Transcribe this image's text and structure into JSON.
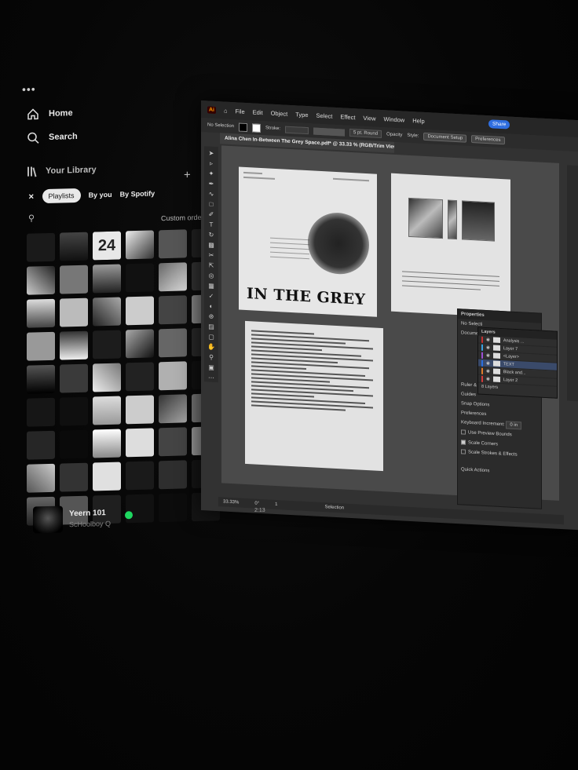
{
  "spotify": {
    "menu_glyph": "•••",
    "nav": [
      {
        "label": "Home",
        "icon": "home-icon"
      },
      {
        "label": "Search",
        "icon": "search-icon"
      }
    ],
    "library_label": "Your Library",
    "add_glyph": "+",
    "close_glyph": "✕",
    "filters": [
      "Playlists",
      "By you",
      "By Spotify"
    ],
    "sort_label": "Custom order",
    "tile_number": "24",
    "now_playing": {
      "title": "Yeern 101",
      "artist": "ScHoolboy Q"
    }
  },
  "illustrator": {
    "app_logo": "Ai",
    "menu": [
      "File",
      "Edit",
      "Object",
      "Type",
      "Select",
      "Effect",
      "View",
      "Window",
      "Help"
    ],
    "share_label": "Share",
    "control_bar": {
      "selection": "No Selection",
      "stroke_label": "Stroke:",
      "brush": "5 pt. Round",
      "opacity_label": "Opacity",
      "style_label": "Style:",
      "document_setup": "Document Setup",
      "preferences": "Preferences"
    },
    "doc_tab": "Alina Chen In-Between The Grey Space.pdf* @ 33.33 % (RGB/Trim View)",
    "artboard_headline": "IN THE GREY",
    "properties": {
      "title": "Properties",
      "no_selection": "No Selecti",
      "document": "Documen",
      "ruler": "Ruler & G",
      "guides": "Guides",
      "snap": "Snap Options",
      "preferences": "Preferences",
      "keyboard_increment": "Keyboard Increment:",
      "increment_value": "0 in",
      "checks": [
        "Use Preview Bounds",
        "Scale Corners",
        "Scale Strokes & Effects"
      ],
      "quick_actions": "Quick Actions"
    },
    "layers": {
      "title": "Layers",
      "count": "8 Layers",
      "items": [
        {
          "name": "Analysis ...",
          "color": "#c43030"
        },
        {
          "name": "Layer 7",
          "color": "#3aa0e0"
        },
        {
          "name": "<Layer>",
          "color": "#9c4fd6"
        },
        {
          "name": "TEXT",
          "color": "#2a6fe0"
        },
        {
          "name": "Black and...",
          "color": "#e07c2a"
        },
        {
          "name": "Layer 2",
          "color": "#d63a3a"
        }
      ]
    },
    "status": {
      "zoom": "33.33%",
      "rotation": "0°",
      "page": "1",
      "tool": "Selection"
    },
    "time": "2:13"
  }
}
